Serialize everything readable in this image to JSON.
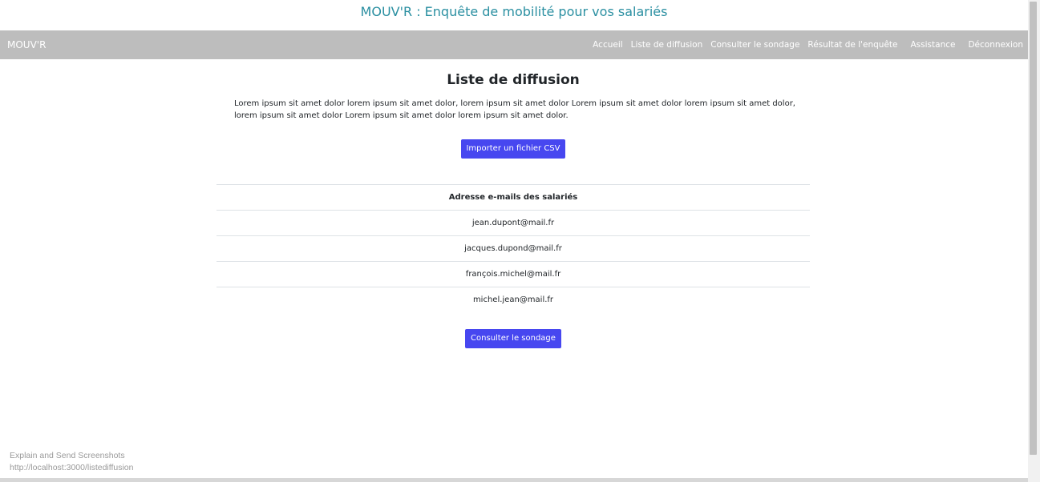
{
  "header": {
    "title": "MOUV'R : Enquête de mobilité pour vos salariés"
  },
  "navbar": {
    "brand": "MOUV'R",
    "links": [
      {
        "label": "Accueil"
      },
      {
        "label": "Liste de diffusion"
      },
      {
        "label": "Consulter le sondage"
      },
      {
        "label": "Résultat de l'enquête"
      },
      {
        "label": "Assistance"
      },
      {
        "label": "Déconnexion"
      }
    ]
  },
  "main": {
    "heading": "Liste de diffusion",
    "intro": "Lorem ipsum sit amet dolor lorem ipsum sit amet dolor, lorem ipsum sit amet dolor Lorem ipsum sit amet dolor lorem ipsum sit amet dolor, lorem ipsum sit amet dolor Lorem ipsum sit amet dolor lorem ipsum sit amet dolor.",
    "import_button": "Importer un fichier CSV",
    "table": {
      "header": "Adresse e-mails des salariés",
      "rows": [
        "jean.dupont@mail.fr",
        "jacques.dupond@mail.fr",
        "françois.michel@mail.fr",
        "michel.jean@mail.fr"
      ]
    },
    "survey_button": "Consulter le sondage"
  },
  "overlay": {
    "line1": "Explain and Send Screenshots",
    "line2": "http://localhost:3000/listediffusion"
  }
}
